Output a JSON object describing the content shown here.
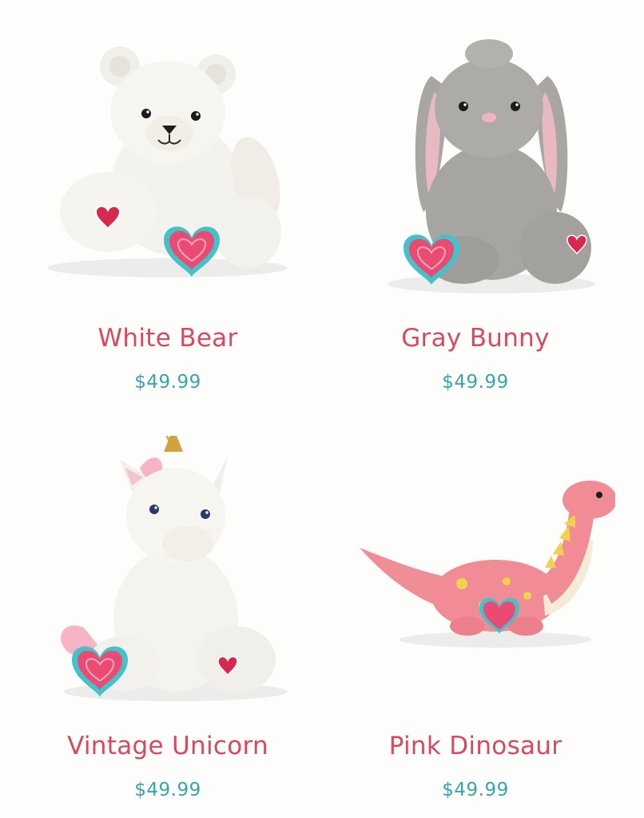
{
  "products": [
    {
      "name": "White Bear",
      "price": "$49.99",
      "image_icon": "white-bear-plush-image"
    },
    {
      "name": "Gray Bunny",
      "price": "$49.99",
      "image_icon": "gray-bunny-plush-image"
    },
    {
      "name": "Vintage Unicorn",
      "price": "$49.99",
      "image_icon": "vintage-unicorn-plush-image"
    },
    {
      "name": "Pink Dinosaur",
      "price": "$49.99",
      "image_icon": "pink-dinosaur-plush-image"
    }
  ],
  "colors": {
    "name_text": "#d8495f",
    "price_text": "#3aa5a8",
    "background": "#fdfdfc",
    "heart_pink": "#e94b73",
    "heart_teal": "#42c3c9"
  }
}
